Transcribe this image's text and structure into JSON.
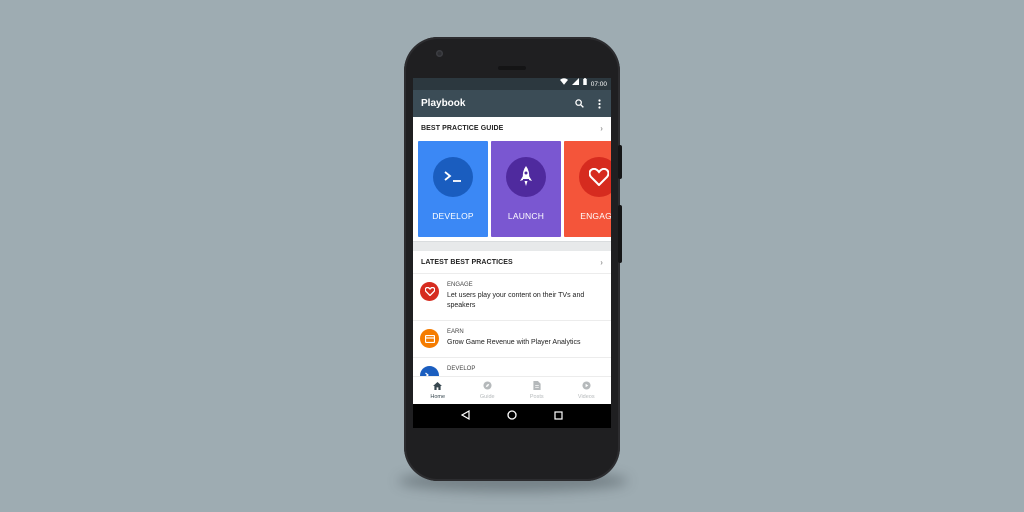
{
  "status_bar": {
    "time": "07:00",
    "icons": [
      "wifi-icon",
      "signal-icon",
      "battery-icon"
    ]
  },
  "app_bar": {
    "title": "Playbook",
    "icons": [
      "search-icon",
      "more-vert-icon"
    ]
  },
  "best_practice_guide": {
    "header": "BEST PRACTICE GUIDE",
    "cards": [
      {
        "label": "DEVELOP",
        "color": "#3b88f5",
        "circle_color": "#1a5dbf",
        "icon": "terminal-icon"
      },
      {
        "label": "LAUNCH",
        "color": "#7a57d1",
        "circle_color": "#4f2a9e",
        "icon": "rocket-icon"
      },
      {
        "label": "ENGAGE",
        "color": "#f4553a",
        "circle_color": "#d62b1f",
        "icon": "heart-icon"
      }
    ]
  },
  "latest_best_practices": {
    "header": "LATEST BEST PRACTICES",
    "items": [
      {
        "category": "ENGAGE",
        "text": "Let users play your content on their TVs and speakers",
        "color": "#d62b1f",
        "icon": "heart-icon"
      },
      {
        "category": "EARN",
        "text": "Grow Game Revenue with Player Analytics",
        "color": "#f57c00",
        "icon": "wallet-icon"
      },
      {
        "category": "DEVELOP",
        "text": "",
        "color": "#1a5dbf",
        "icon": "terminal-icon"
      }
    ]
  },
  "bottom_nav": [
    {
      "label": "Home",
      "icon": "home-icon",
      "active": true
    },
    {
      "label": "Guide",
      "icon": "compass-icon",
      "active": false
    },
    {
      "label": "Posts",
      "icon": "document-icon",
      "active": false
    },
    {
      "label": "Videos",
      "icon": "play-circle-icon",
      "active": false
    }
  ],
  "colors": {
    "background": "#9eacb2",
    "app_bar": "#3b4c56",
    "status_bar": "#2c383f"
  }
}
